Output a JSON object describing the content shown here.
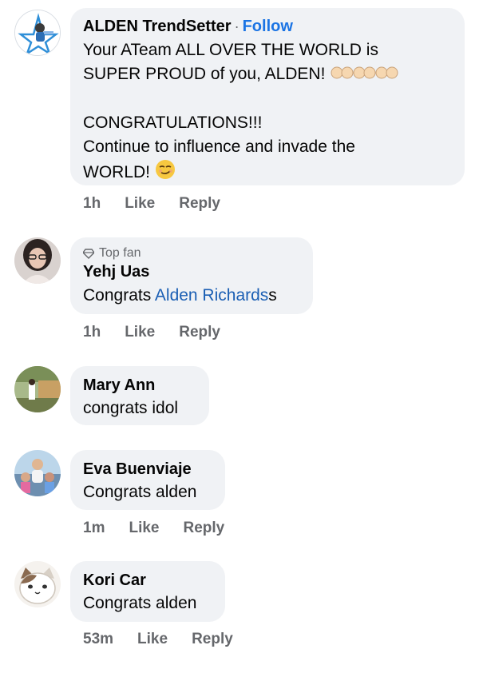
{
  "comments": [
    {
      "author": "ALDEN TrendSetter",
      "follow_label": "Follow",
      "separator": "·",
      "lines": [
        "Your ATeam ALL OVER THE WORLD is",
        "SUPER PROUD of you, ALDEN!",
        "",
        "CONGRATULATIONS!!!",
        "Continue to influence and invade the",
        "WORLD!"
      ],
      "time": "1h",
      "like": "Like",
      "reply": "Reply",
      "avatar_icon": "star-logo-icon"
    },
    {
      "badge": "Top fan",
      "author": "Yehj Uas",
      "text_prefix": "Congrats ",
      "mention": "Alden Richards",
      "text_suffix": "s",
      "time": "1h",
      "like": "Like",
      "reply": "Reply",
      "badge_icon": "diamond-icon"
    },
    {
      "author": "Mary Ann",
      "text": "congrats idol"
    },
    {
      "author": "Eva Buenviaje",
      "text": "Congrats alden",
      "time": "1m",
      "like": "Like",
      "reply": "Reply"
    },
    {
      "author": "Kori Car",
      "text": "Congrats alden",
      "time": "53m",
      "like": "Like",
      "reply": "Reply"
    }
  ],
  "colors": {
    "bubble": "#f0f2f5",
    "link": "#1b74e4",
    "meta": "#65676b"
  }
}
